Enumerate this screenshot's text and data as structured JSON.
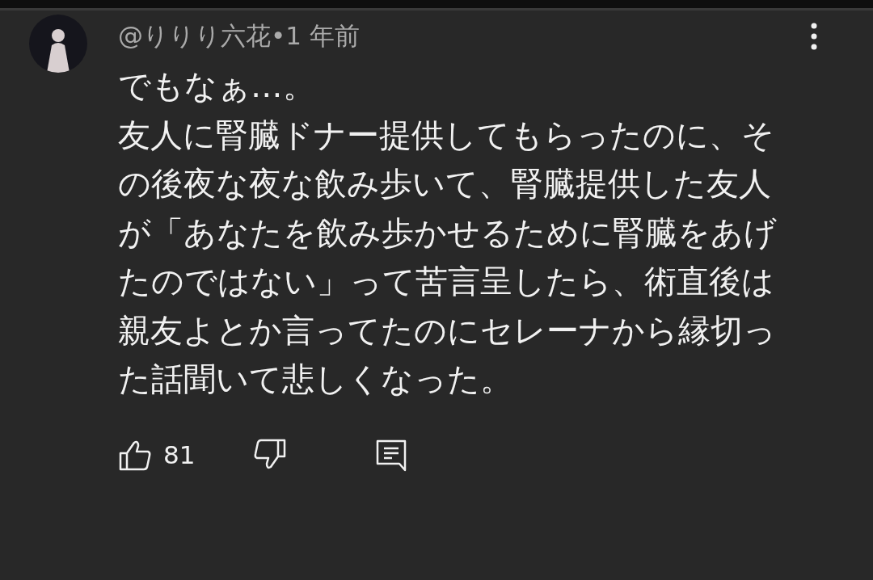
{
  "comment": {
    "author": "@りりり六花",
    "separator": "•",
    "time": "1 年前",
    "paragraphs": [
      "でもなぁ…。",
      "友人に腎臓ドナー提供してもらったのに、その後夜な夜な飲み歩いて、腎臓提供した友人が「あなたを飲み歩かせるために腎臓をあげたのではない」って苦言呈したら、術直後は親友よとか言ってたのにセレーナから縁切った話聞いて悲しくなった。"
    ],
    "likes": "81"
  }
}
